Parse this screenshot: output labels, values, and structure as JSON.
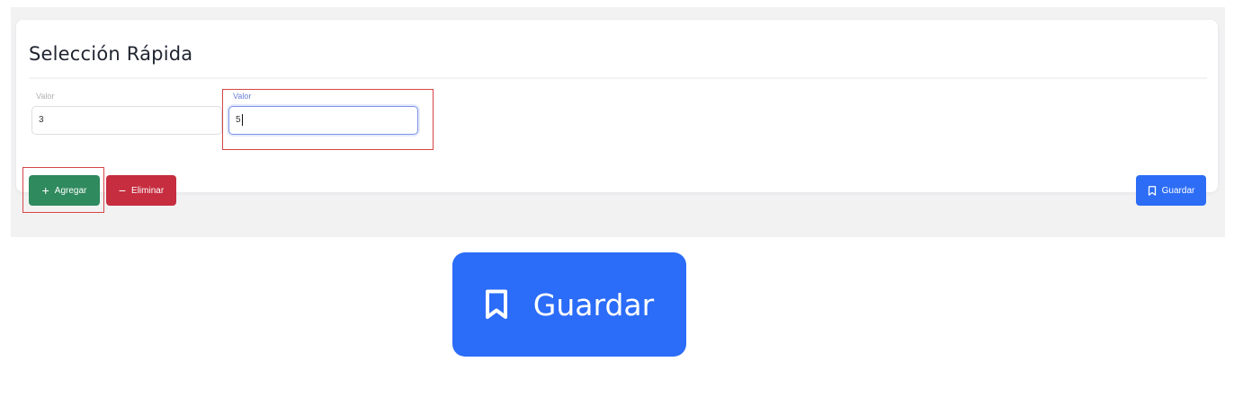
{
  "section": {
    "title": "Selección Rápida"
  },
  "fields": [
    {
      "label": "Valor",
      "value": "3"
    },
    {
      "label": "Valor",
      "value": "5"
    }
  ],
  "buttons": {
    "add_label": "Agregar",
    "remove_label": "Eliminar",
    "save_label": "Guardar"
  },
  "zoom_button": {
    "label": "Guardar"
  },
  "icons": {
    "add": "plus-icon",
    "remove": "minus-icon",
    "save": "bookmark-icon"
  },
  "colors": {
    "add_button": "#2f8a5e",
    "remove_button": "#c62d3f",
    "save_button": "#2d6df6",
    "highlight": "#d64545",
    "focus_border": "#7b93e6"
  }
}
